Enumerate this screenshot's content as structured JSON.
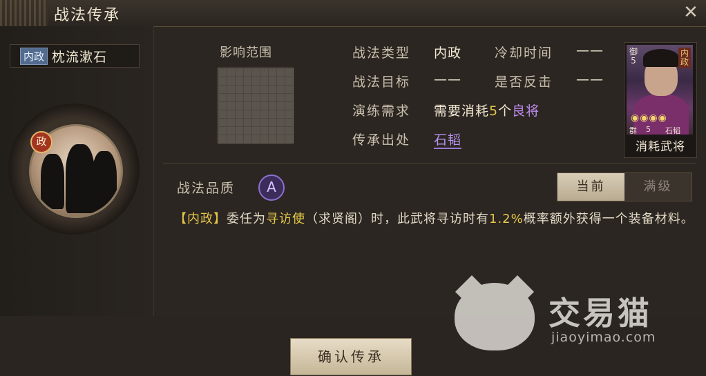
{
  "window": {
    "title": "战法传承"
  },
  "skill": {
    "type_badge": "内政",
    "name": "枕流漱石",
    "portrait_badge": "政"
  },
  "range": {
    "label": "影响范围"
  },
  "info": {
    "type_label": "战法类型",
    "type_value": "内政",
    "cooldown_label": "冷却时间",
    "cooldown_value": "——",
    "target_label": "战法目标",
    "target_value": "——",
    "counter_label": "是否反击",
    "counter_value": "——",
    "training_label": "演练需求",
    "training_prefix": "需要消耗",
    "training_count": "5",
    "training_unit": "个",
    "training_item": "良将",
    "origin_label": "传承出处",
    "origin_value": "石韬"
  },
  "card": {
    "type": "内政",
    "cost_label": "御",
    "cost_value": "5",
    "stars": "◉◉◉◉",
    "faction": "群",
    "level": "5",
    "name": "石韬",
    "caption": "消耗武将"
  },
  "quality": {
    "label": "战法品质",
    "grade": "A"
  },
  "toggle": {
    "current": "当前",
    "max": "满级"
  },
  "description": {
    "tag": "【内政】",
    "part1": "委任为",
    "highlight1": "寻访使",
    "part2": "（求贤阁）时，此武将寻访时有",
    "highlight2": "1.2%",
    "part3": "概率额外获得一个装备材料。"
  },
  "actions": {
    "confirm": "确认传承"
  },
  "watermark": {
    "brand": "交易猫",
    "url": "jiaoyimao.com"
  },
  "colors": {
    "accent_yellow": "#e8c94a",
    "accent_purple": "#c08cf0",
    "badge_blue": "#526b8e"
  }
}
